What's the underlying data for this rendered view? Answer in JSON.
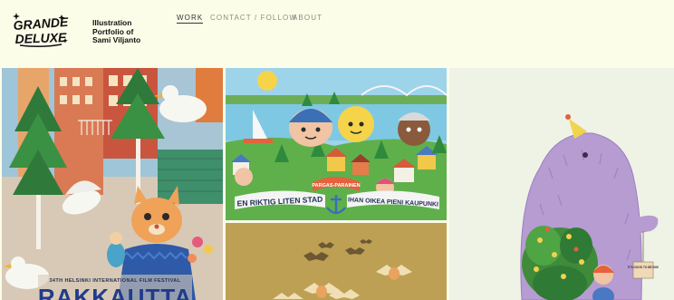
{
  "header": {
    "logo": {
      "line1": "GRANDE",
      "line2": "DELUXE"
    },
    "site_title": [
      "Illustration",
      "Portfolio of",
      "Sami Viljanto"
    ],
    "nav": [
      {
        "label": "WORK",
        "active": true
      },
      {
        "label": "CONTACT / FOLLOW",
        "active": false
      },
      {
        "label": "ABOUT",
        "active": false
      }
    ]
  },
  "gallery": {
    "tile_1": {
      "subject": "poster illustration: city with seagulls, cat, birch trees",
      "caption_small": "34TH HELSINKI INTERNATIONAL FILM FESTIVAL",
      "caption_big": "RAKKAUTTA"
    },
    "tile_2": {
      "subject": "illustration of a small town with smiling characters",
      "banner_top": "PARGAS-PARAINEN",
      "banner_left": "EN RIKTIG LITEN STAD",
      "banner_right": "IHAN OIKEA PIENI KAUPUNKI"
    },
    "tile_3": {
      "subject": "illustration of winged bats on an ochre background"
    },
    "tile_4": {
      "subject": "illustration of a furry purple monster with a party hat holding a plant",
      "sign_text": "IT'S GOOD TO BE BIG!"
    }
  },
  "colors": {
    "page_background": "#fcfde9",
    "nav_text": "#8c8c84",
    "nav_active": "#333333",
    "title_text": "#111111"
  }
}
